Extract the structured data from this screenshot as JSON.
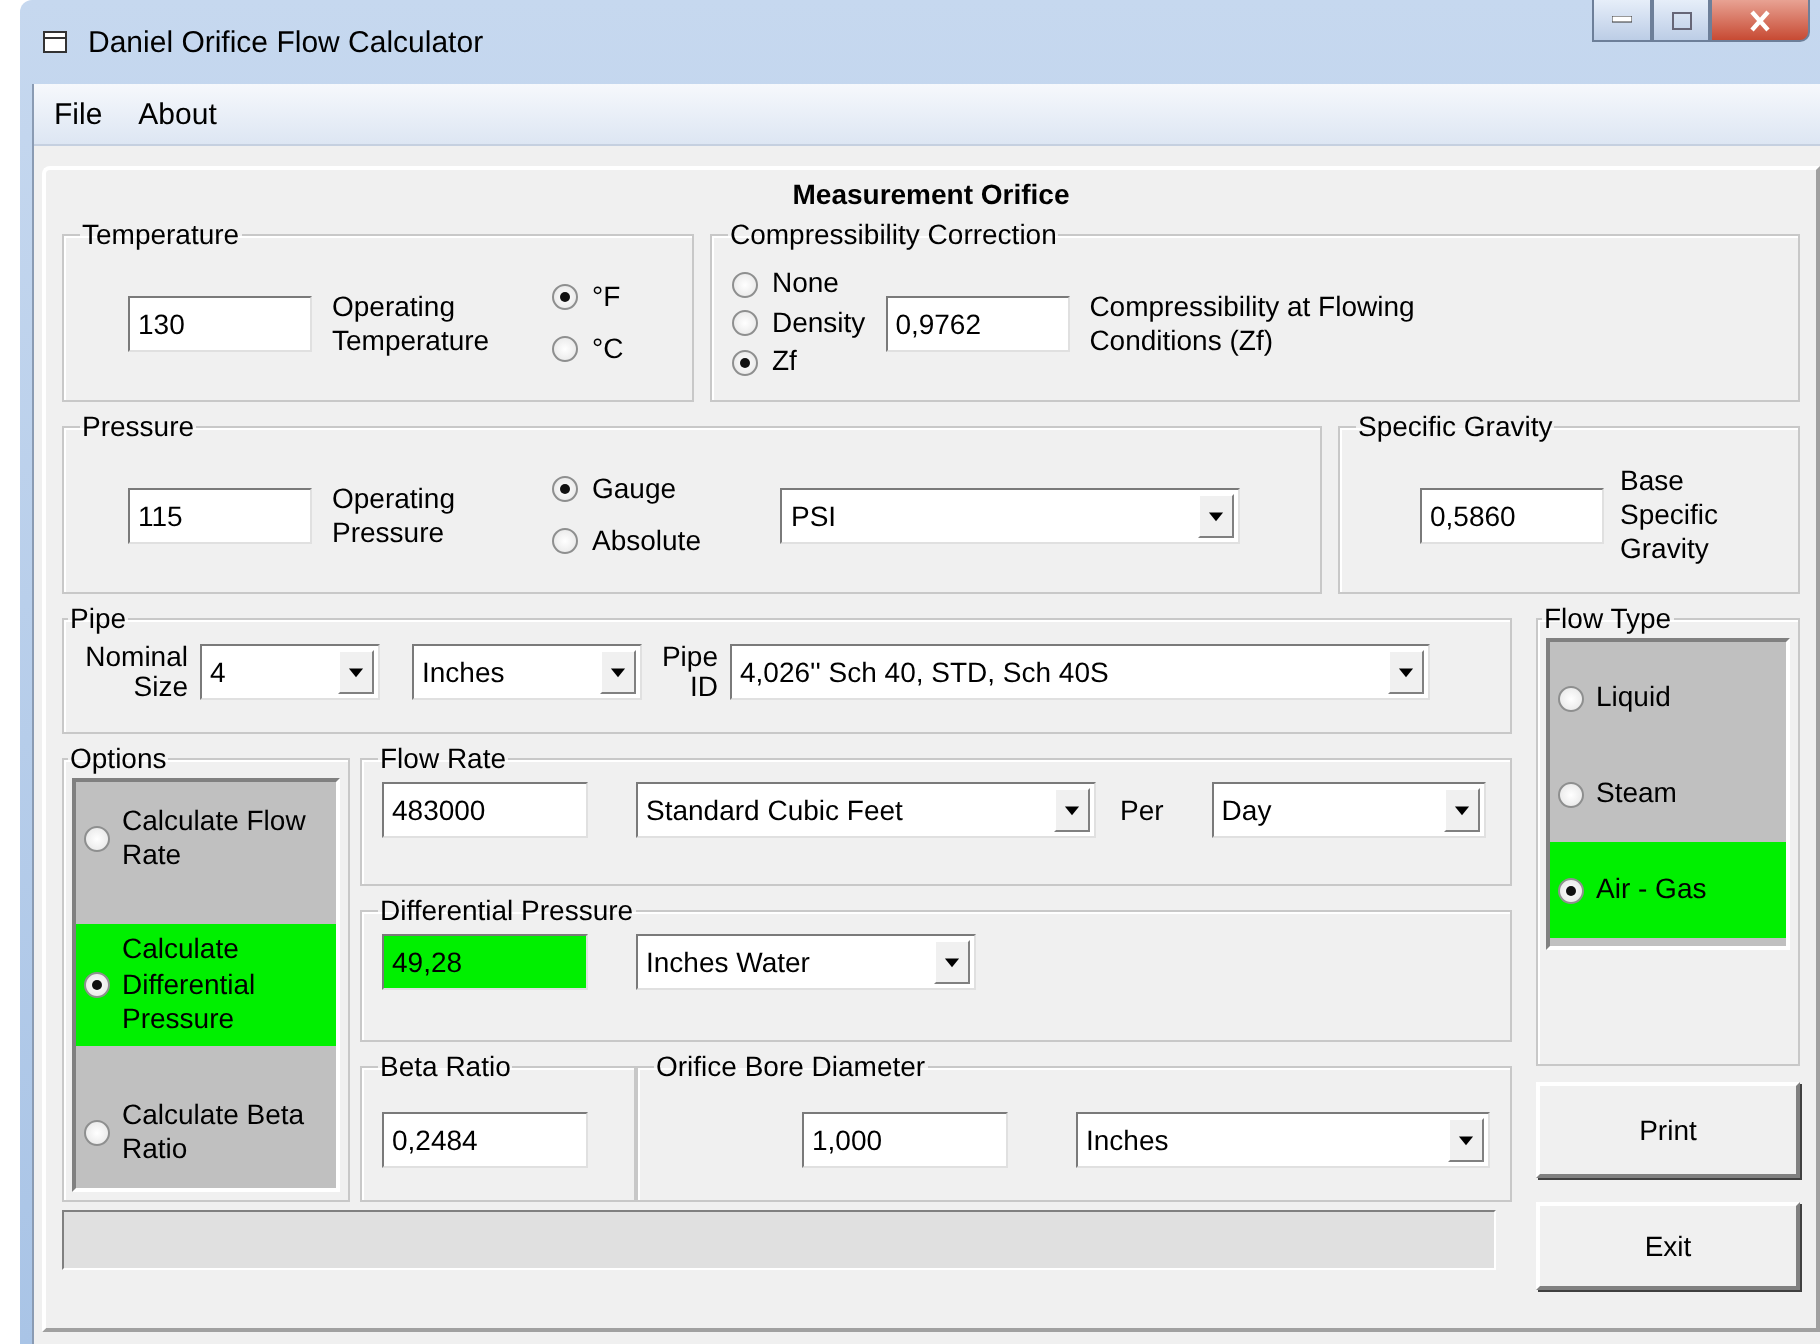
{
  "window": {
    "title": "Daniel Orifice Flow Calculator"
  },
  "menu": [
    "File",
    "About"
  ],
  "heading": "Measurement Orifice",
  "temperature": {
    "label": "Temperature",
    "value": "130",
    "caption": "Operating Temperature",
    "units": [
      {
        "label": "°F",
        "selected": true
      },
      {
        "label": "°C",
        "selected": false
      }
    ]
  },
  "compressibility": {
    "label": "Compressibility Correction",
    "options": [
      {
        "label": "None",
        "selected": false
      },
      {
        "label": "Density",
        "selected": false
      },
      {
        "label": "Zf",
        "selected": true
      }
    ],
    "value": "0,9762",
    "caption": "Compressibility at Flowing Conditions (Zf)"
  },
  "pressure": {
    "label": "Pressure",
    "value": "115",
    "caption": "Operating Pressure",
    "modes": [
      {
        "label": "Gauge",
        "selected": true
      },
      {
        "label": "Absolute",
        "selected": false
      }
    ],
    "unit": "PSI"
  },
  "specific_gravity": {
    "label": "Specific Gravity",
    "value": "0,5860",
    "caption": "Base Specific Gravity"
  },
  "pipe": {
    "label": "Pipe",
    "size_label": "Nominal Size",
    "size": "4",
    "size_unit": "Inches",
    "id_label": "Pipe ID",
    "id": "4,026''  Sch 40, STD, Sch 40S"
  },
  "options": {
    "label": "Options",
    "items": [
      {
        "label": "Calculate Flow Rate",
        "selected": false
      },
      {
        "label": "Calculate Differential Pressure",
        "selected": true
      },
      {
        "label": "Calculate Beta Ratio",
        "selected": false
      }
    ]
  },
  "flow_rate": {
    "label": "Flow Rate",
    "value": "483000",
    "unit": "Standard Cubic Feet",
    "per_label": "Per",
    "per": "Day",
    "calculated": false
  },
  "differential_pressure": {
    "label": "Differential Pressure",
    "value": "49,28",
    "unit": "Inches Water",
    "calculated": true
  },
  "beta_ratio": {
    "label": "Beta Ratio",
    "value": "0,2484",
    "calculated": false
  },
  "bore": {
    "label": "Orifice Bore Diameter",
    "value": "1,000",
    "unit": "Inches"
  },
  "flow_type": {
    "label": "Flow Type",
    "items": [
      {
        "label": "Liquid",
        "selected": false
      },
      {
        "label": "Steam",
        "selected": false
      },
      {
        "label": "Air - Gas",
        "selected": true
      }
    ]
  },
  "buttons": [
    "Print",
    "Exit"
  ]
}
